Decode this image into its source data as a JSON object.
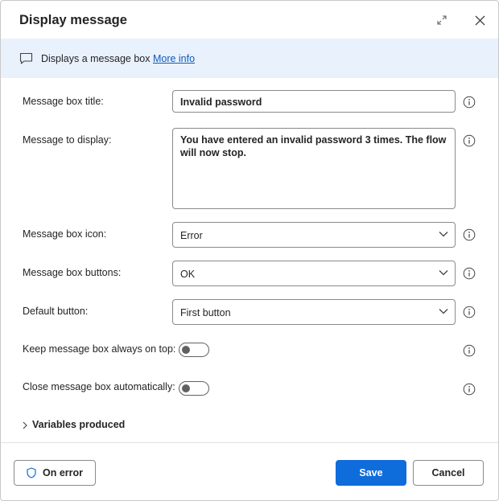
{
  "dialog": {
    "title": "Display message",
    "expand_icon": "expand-icon",
    "close_icon": "close-icon"
  },
  "banner": {
    "icon": "chat-bubble-icon",
    "text": "Displays a message box ",
    "link": "More info"
  },
  "form": {
    "title_label": "Message box title:",
    "title_value": "Invalid password",
    "message_label": "Message to display:",
    "message_value": "You have entered an invalid password 3 times. The flow will now stop.",
    "icon_label": "Message box icon:",
    "icon_value": "Error",
    "buttons_label": "Message box buttons:",
    "buttons_value": "OK",
    "default_label": "Default button:",
    "default_value": "First button",
    "ontop_label": "Keep message box always on top:",
    "ontop_value": "off",
    "autoclose_label": "Close message box automatically:",
    "autoclose_value": "off"
  },
  "variables": {
    "label": "Variables produced"
  },
  "footer": {
    "on_error": "On error",
    "save": "Save",
    "cancel": "Cancel"
  },
  "colors": {
    "accent": "#0f6cdb",
    "banner_bg": "#e9f1fc",
    "link": "#0f5bb8"
  }
}
